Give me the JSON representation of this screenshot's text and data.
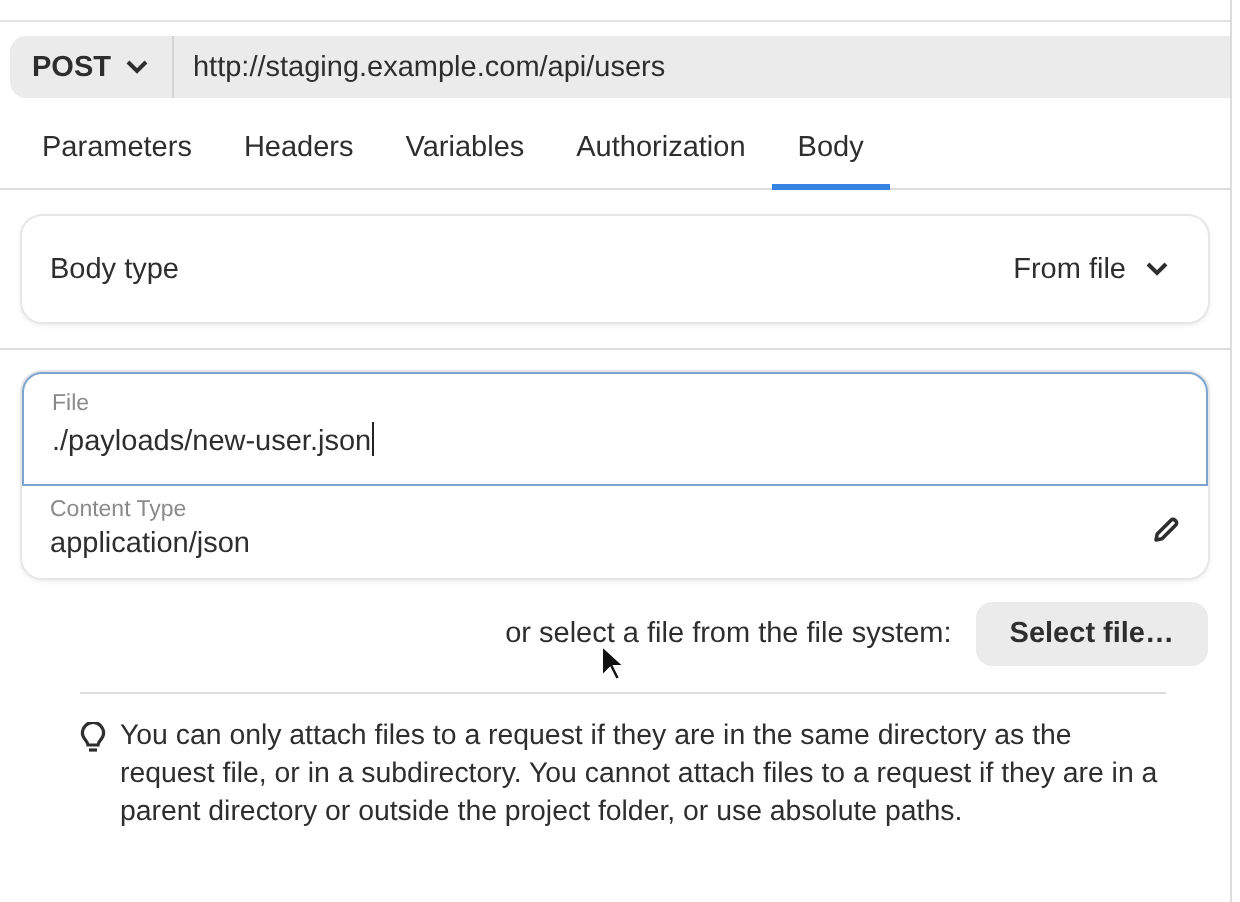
{
  "request": {
    "method": "POST",
    "url": "http://staging.example.com/api/users"
  },
  "tabs": [
    {
      "label": "Parameters",
      "selected": false
    },
    {
      "label": "Headers",
      "selected": false
    },
    {
      "label": "Variables",
      "selected": false
    },
    {
      "label": "Authorization",
      "selected": false
    },
    {
      "label": "Body",
      "selected": true
    }
  ],
  "body_type": {
    "label": "Body type",
    "value": "From file"
  },
  "file_field": {
    "label": "File",
    "value": "./payloads/new-user.json",
    "focused": true
  },
  "content_type": {
    "label": "Content Type",
    "value": "application/json"
  },
  "select_row": {
    "text": "or select a file from the file system:",
    "button": "Select file…"
  },
  "tip": "You can only attach files to a request if they are in the same directory as the request file, or in a subdirectory. You cannot attach files to a request if they are in a parent directory or outside the project folder, or use absolute paths."
}
